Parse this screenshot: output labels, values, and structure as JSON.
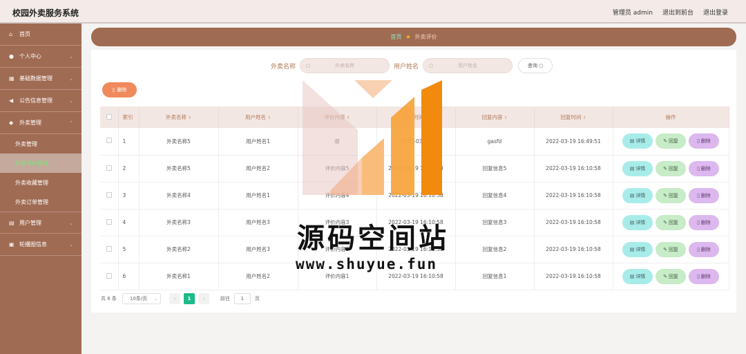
{
  "app": {
    "title": "校园外卖服务系统"
  },
  "header": {
    "admin_label": "管理员 admin",
    "front_label": "退出到前台",
    "logout_label": "退出登录"
  },
  "sidebar": {
    "home": "首页",
    "personal": "个人中心",
    "base_data": "基础数据管理",
    "notice": "公告信息管理",
    "takeaway": "外卖管理",
    "sub": [
      "外卖管理",
      "外卖评价管理",
      "外卖收藏管理",
      "外卖订单管理"
    ],
    "user": "用户管理",
    "carousel": "轮播图信息"
  },
  "breadcrumb": {
    "home": "首页",
    "current": "外卖评价"
  },
  "search": {
    "name_label": "外卖名称",
    "name_placeholder": "外卖名称",
    "user_label": "用户姓名",
    "user_placeholder": "用户姓名",
    "button": "查询"
  },
  "toolbar": {
    "delete_label": "删除"
  },
  "table": {
    "headers": [
      "索引",
      "外卖名称",
      "用户姓名",
      "评价内容",
      "评价时间",
      "回复内容",
      "回复时间",
      "操作"
    ],
    "rows": [
      {
        "idx": "1",
        "name": "外卖名称5",
        "user": "用户姓名1",
        "content": "很",
        "time": "2022-03-19",
        "reply": "gasfd",
        "reply_time": "2022-03-19 16:49:51"
      },
      {
        "idx": "2",
        "name": "外卖名称5",
        "user": "用户姓名2",
        "content": "评价内容5",
        "time": "2022-03-19 16:10:58",
        "reply": "回复信息5",
        "reply_time": "2022-03-19 16:10:58"
      },
      {
        "idx": "3",
        "name": "外卖名称4",
        "user": "用户姓名1",
        "content": "评价内容4",
        "time": "2022-03-19 16:10:58",
        "reply": "回复信息4",
        "reply_time": "2022-03-19 16:10:58"
      },
      {
        "idx": "4",
        "name": "外卖名称3",
        "user": "用户姓名3",
        "content": "评价内容3",
        "time": "2022-03-19 16:10:58",
        "reply": "回复信息3",
        "reply_time": "2022-03-19 16:10:58"
      },
      {
        "idx": "5",
        "name": "外卖名称2",
        "user": "用户姓名3",
        "content": "评价内容2",
        "time": "2022-03-19 16:10:58",
        "reply": "回复信息2",
        "reply_time": "2022-03-19 16:10:58"
      },
      {
        "idx": "6",
        "name": "外卖名称1",
        "user": "用户姓名2",
        "content": "评价内容1",
        "time": "2022-03-19 16:10:58",
        "reply": "回复信息1",
        "reply_time": "2022-03-19 16:10:58"
      }
    ],
    "actions": {
      "detail": "详情",
      "reply": "回复",
      "delete": "删除"
    }
  },
  "pagination": {
    "total": "共 6 条",
    "page_size": "10条/页",
    "current": "1",
    "goto_label": "前往",
    "goto_value": "1",
    "page_unit": "页"
  },
  "watermark": {
    "title": "源码空间站",
    "url": "www.shuyue.fun"
  },
  "colors": {
    "sidebar": "#a06b53",
    "accent": "#f08a5d",
    "active_page": "#1dbb8a"
  }
}
